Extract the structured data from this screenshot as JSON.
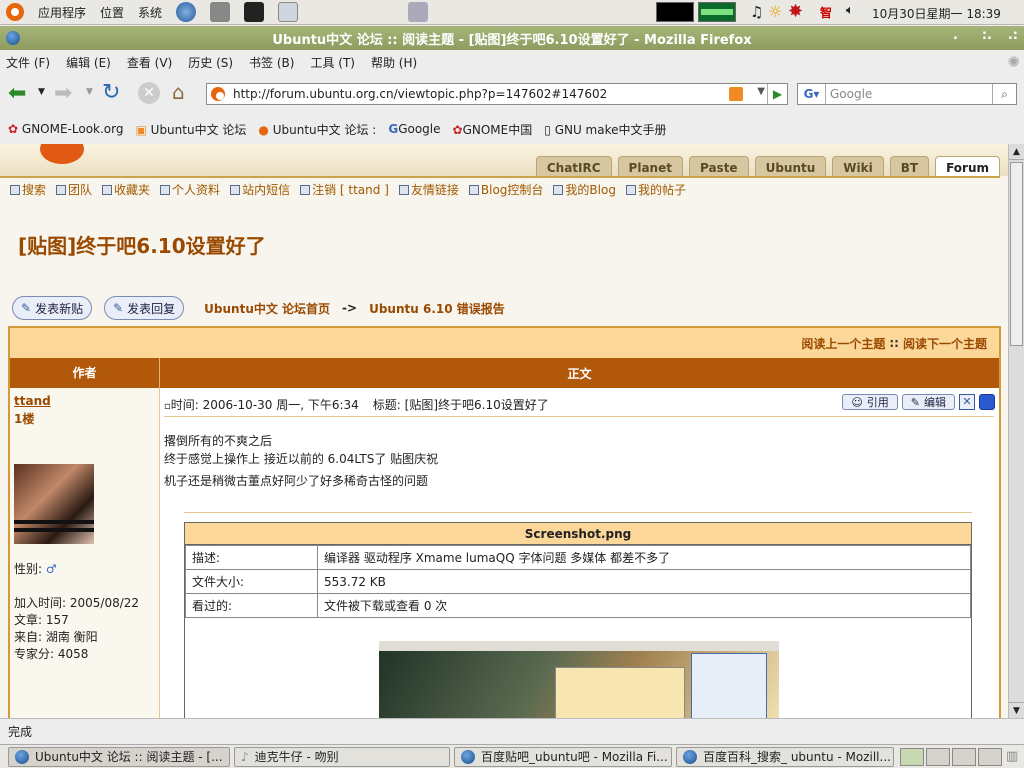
{
  "panel": {
    "menus": [
      "应用程序",
      "位置",
      "系统"
    ],
    "clock": "10月30日星期一 18:39",
    "ime": "智"
  },
  "window": {
    "title": "Ubuntu中文 论坛 :: 阅读主题 - [贴图]终于吧6.10设置好了 - Mozilla Firefox"
  },
  "menubar": [
    "文件 (F)",
    "编辑 (E)",
    "查看 (V)",
    "历史 (S)",
    "书签 (B)",
    "工具 (T)",
    "帮助 (H)"
  ],
  "navbar": {
    "url": "http://forum.ubuntu.org.cn/viewtopic.php?p=147602#147602",
    "search_placeholder": "Google"
  },
  "bookmarks": [
    "GNOME-Look.org",
    "Ubuntu中文 论坛",
    "Ubuntu中文 论坛 :",
    "Google",
    "GNOME中国",
    "GNU make中文手册"
  ],
  "site": {
    "tabs": [
      "ChatIRC",
      "Planet",
      "Paste",
      "Ubuntu",
      "Wiki",
      "BT",
      "Forum"
    ],
    "forumnav": [
      "搜索",
      "团队",
      "收藏夹",
      "个人资料",
      "站内短信",
      "注销 [ ttand ]",
      "友情链接",
      "Blog控制台",
      "我的Blog",
      "我的帖子"
    ]
  },
  "topic": {
    "title": "[贴图]终于吧6.10设置好了",
    "new_post": "发表新贴",
    "reply": "发表回复",
    "breadcrumb_home": "Ubuntu中文 论坛首页",
    "breadcrumb_sep": "->",
    "breadcrumb_forum": "Ubuntu 6.10 错误报告",
    "prev_topic": "阅读上一个主题",
    "sep": "::",
    "next_topic": "阅读下一个主题",
    "col_author": "作者",
    "col_body": "正文"
  },
  "post": {
    "author": "ttand",
    "floor": "1楼",
    "gender_label": "性别:",
    "join": "加入时间: 2005/08/22",
    "posts": "文章: 157",
    "from": "来自: 湖南 衡阳",
    "score": "专家分: 4058",
    "time": "时间: 2006-10-30 周一, 下午6:34",
    "subject": "标题: [贴图]终于吧6.10设置好了",
    "quote": "引用",
    "edit": "编辑",
    "lines": [
      "撂倒所有的不爽之后",
      "终于感觉上操作上 接近以前的 6.04LTS了 贴图庆祝",
      "机子还是稍微古董点好阿少了好多稀奇古怪的问题"
    ]
  },
  "attachment": {
    "filename": "Screenshot.png",
    "rows": [
      {
        "label": "描述:",
        "value": "编译器 驱动程序 Xmame lumaQQ 字体问题 多媒体 都差不多了"
      },
      {
        "label": "文件大小:",
        "value": "553.72 KB"
      },
      {
        "label": "看过的:",
        "value": "文件被下载或查看 0 次"
      }
    ]
  },
  "status": "完成",
  "tasks": [
    "Ubuntu中文 论坛 :: 阅读主题 - [...",
    "迪克牛仔 - 吻别",
    "百度贴吧_ubuntu吧 - Mozilla Fi...",
    "百度百科_搜索_ ubuntu - Mozill..."
  ]
}
